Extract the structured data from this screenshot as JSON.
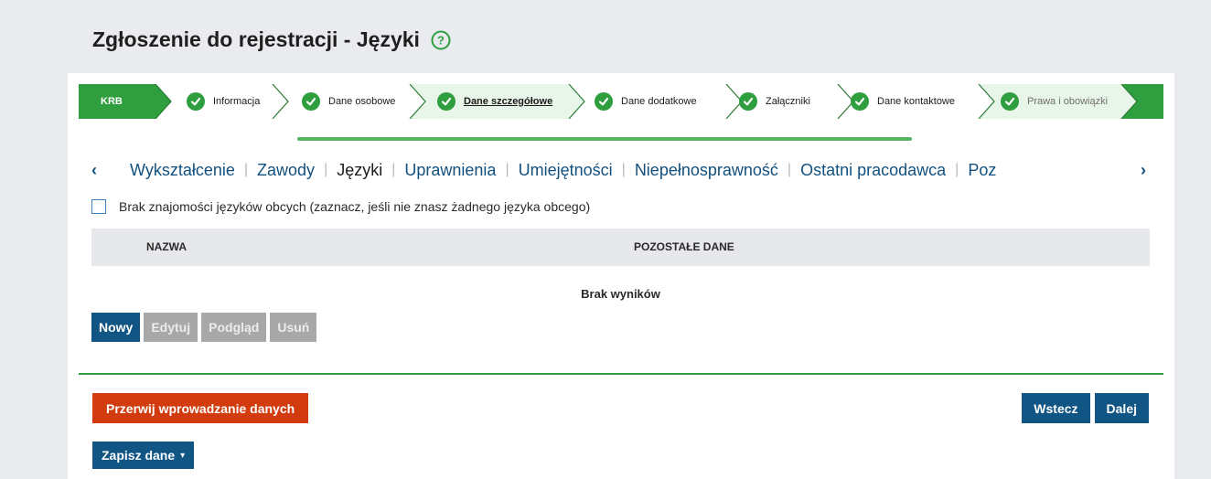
{
  "header": {
    "title": "Zgłoszenie do rejestracji - Języki",
    "help_icon": "question-circle-icon"
  },
  "stepper": {
    "steps": [
      {
        "label": "KRB",
        "state": "start"
      },
      {
        "label": "Informacja",
        "state": "done"
      },
      {
        "label": "Dane osobowe",
        "state": "done"
      },
      {
        "label": "Dane szczegółowe",
        "state": "current"
      },
      {
        "label": "Dane dodatkowe",
        "state": "done"
      },
      {
        "label": "Załączniki",
        "state": "done"
      },
      {
        "label": "Dane kontaktowe",
        "state": "done"
      },
      {
        "label": "Prawa i obowiązki",
        "state": "muted"
      }
    ],
    "accent": "#2f9e3e"
  },
  "subnav": {
    "items": [
      "Wykształcenie",
      "Zawody",
      "Języki",
      "Uprawnienia",
      "Umiejętności",
      "Niepełnosprawność",
      "Ostatni pracodawca",
      "Poz"
    ],
    "active": "Języki"
  },
  "no_languages": {
    "label": "Brak znajomości języków obcych (zaznacz, jeśli nie znasz żadnego języka obcego)",
    "checked": false
  },
  "table": {
    "columns": [
      "NAZWA",
      "POZOSTAŁE DANE"
    ],
    "empty_text": "Brak wyników"
  },
  "actions": {
    "new": "Nowy",
    "edit": "Edytuj",
    "preview": "Podgląd",
    "delete": "Usuń"
  },
  "footer": {
    "abort": "Przerwij wprowadzanie danych",
    "back": "Wstecz",
    "next": "Dalej",
    "save": "Zapisz dane"
  },
  "colors": {
    "primary": "#115584",
    "danger": "#d13b0d",
    "green": "#2f9e3e"
  }
}
